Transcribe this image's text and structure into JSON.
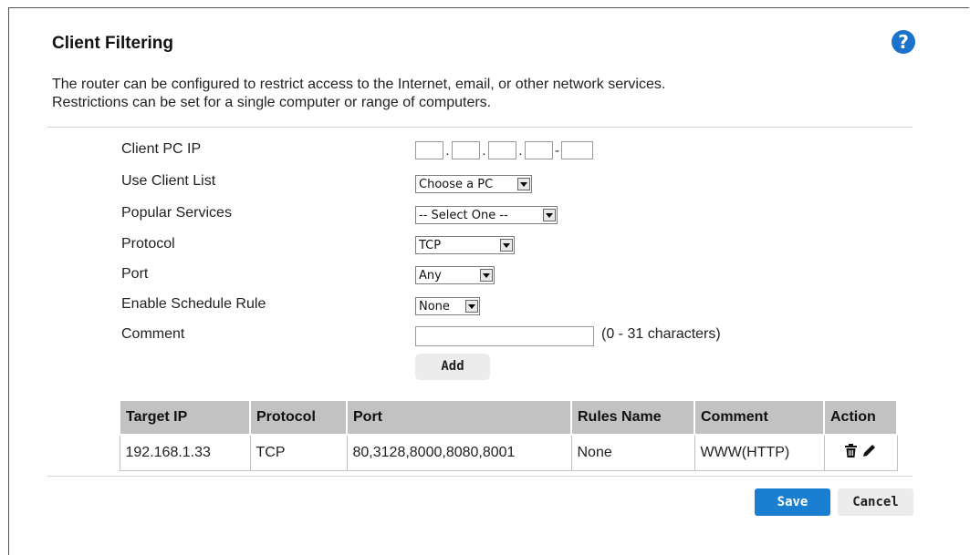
{
  "header": {
    "title": "Client Filtering",
    "help_icon": "?",
    "description_line1": "The router can be configured to restrict access to the Internet, email, or other network services.",
    "description_line2": "Restrictions can be set for a single computer or range of computers."
  },
  "form": {
    "client_pc_ip": {
      "label": "Client PC IP",
      "dot": ".",
      "dash": "-"
    },
    "use_client_list": {
      "label": "Use Client List",
      "value": "Choose a PC"
    },
    "popular_services": {
      "label": "Popular Services",
      "value": "-- Select One --"
    },
    "protocol": {
      "label": "Protocol",
      "value": "TCP"
    },
    "port": {
      "label": "Port",
      "value": "Any"
    },
    "schedule_rule": {
      "label": "Enable Schedule Rule",
      "value": "None"
    },
    "comment": {
      "label": "Comment",
      "hint": "(0 - 31 characters)",
      "value": ""
    },
    "add_label": "Add"
  },
  "table": {
    "headers": [
      "Target IP",
      "Protocol",
      "Port",
      "Rules Name",
      "Comment",
      "Action"
    ],
    "rows": [
      {
        "target_ip": "192.168.1.33",
        "protocol": "TCP",
        "port": "80,3128,8000,8080,8001",
        "rules_name": "None",
        "comment": "WWW(HTTP)",
        "icons": [
          "trash-icon",
          "pencil-icon"
        ]
      }
    ]
  },
  "footer": {
    "save_label": "Save",
    "cancel_label": "Cancel"
  },
  "colors": {
    "accent": "#1a7fd0",
    "help": "#1a73c9",
    "table_header": "#c2c2c2"
  }
}
